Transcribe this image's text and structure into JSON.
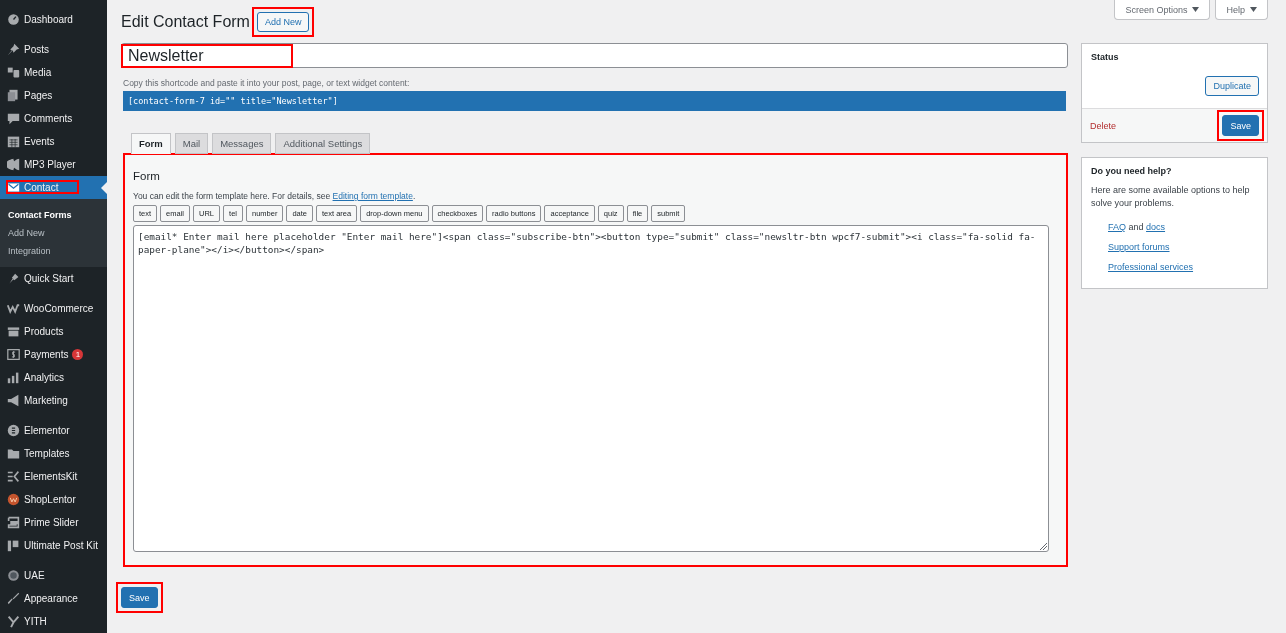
{
  "screen_meta": [
    {
      "label": "Screen Options"
    },
    {
      "label": "Help"
    }
  ],
  "admin_menu": {
    "groups": [
      [
        {
          "label": "Dashboard",
          "selected": false,
          "annotated": false
        }
      ],
      [
        {
          "label": "Posts",
          "selected": false,
          "annotated": false
        },
        {
          "label": "Media",
          "selected": false,
          "annotated": false
        },
        {
          "label": "Pages",
          "selected": false,
          "annotated": false
        },
        {
          "label": "Comments",
          "selected": false,
          "annotated": false
        },
        {
          "label": "Events",
          "selected": false,
          "annotated": false
        },
        {
          "label": "MP3 Player",
          "selected": false,
          "annotated": false
        },
        {
          "label": "Contact",
          "selected": true,
          "annotated": true,
          "submenu": [
            {
              "label": "Contact Forms",
              "selected": true
            },
            {
              "label": "Add New",
              "selected": false
            },
            {
              "label": "Integration",
              "selected": false
            }
          ]
        }
      ],
      [
        {
          "label": "Quick Start",
          "selected": false,
          "annotated": false
        }
      ],
      [
        {
          "label": "WooCommerce",
          "selected": false,
          "annotated": false
        },
        {
          "label": "Products",
          "selected": false,
          "annotated": false
        },
        {
          "label": "Payments",
          "selected": false,
          "annotated": false,
          "badge": "1"
        },
        {
          "label": "Analytics",
          "selected": false,
          "annotated": false
        },
        {
          "label": "Marketing",
          "selected": false,
          "annotated": false
        }
      ],
      [
        {
          "label": "Elementor",
          "selected": false,
          "annotated": false
        },
        {
          "label": "Templates",
          "selected": false,
          "annotated": false
        },
        {
          "label": "ElementsKit",
          "selected": false,
          "annotated": false
        },
        {
          "label": "ShopLentor",
          "selected": false,
          "annotated": false
        },
        {
          "label": "Prime Slider",
          "selected": false,
          "annotated": false
        },
        {
          "label": "Ultimate Post Kit",
          "selected": false,
          "annotated": false
        }
      ],
      [
        {
          "label": "UAE",
          "selected": false,
          "annotated": false
        },
        {
          "label": "Appearance",
          "selected": false,
          "annotated": false
        },
        {
          "label": "YITH",
          "selected": false,
          "annotated": false
        }
      ]
    ]
  },
  "editor": {
    "title": "Edit Contact Form",
    "add_new": {
      "label": "Add New",
      "annotated": true
    },
    "title_field": {
      "value": "Newsletter",
      "annotated": true
    },
    "shortcode_hint": "Copy this shortcode and paste it into your post, page, or text widget content:",
    "shortcode": "[contact-form-7 id=\"\" title=\"Newsletter\"]",
    "tabs": [
      {
        "label": "Form",
        "selected": true
      },
      {
        "label": "Mail",
        "selected": false
      },
      {
        "label": "Messages",
        "selected": false
      },
      {
        "label": "Additional Settings",
        "selected": false
      }
    ],
    "panel": {
      "annotated": true,
      "heading": "Form",
      "description": "You can edit the form template here. For details, see ",
      "description_link": "Editing form template",
      "description_end": ".",
      "tag_buttons": [
        "text",
        "email",
        "URL",
        "tel",
        "number",
        "date",
        "text area",
        "drop-down menu",
        "checkboxes",
        "radio buttons",
        "acceptance",
        "quiz",
        "file",
        "submit"
      ],
      "template": "[email* Enter mail here placeholder \"Enter mail here\"]<span class=\"subscribe-btn\"><button type=\"submit\" class=\"newsltr-btn wpcf7-submit\"><i class=\"fa-solid fa-paper-plane\"></i></button></span>"
    },
    "save_button": {
      "label": "Save",
      "annotated": true
    }
  },
  "status_box": {
    "title": "Status",
    "duplicate": "Duplicate",
    "delete": "Delete",
    "save": {
      "label": "Save",
      "annotated": true
    }
  },
  "help_box": {
    "title": "Do you need help?",
    "text": "Here are some available options to help solve your problems.",
    "links": [
      {
        "parts": [
          {
            "text": "FAQ",
            "link": true
          },
          {
            "text": " and ",
            "link": false
          },
          {
            "text": "docs",
            "link": true
          }
        ]
      },
      {
        "parts": [
          {
            "text": "Support forums",
            "link": true
          }
        ]
      },
      {
        "parts": [
          {
            "text": "Professional services",
            "link": true
          }
        ]
      }
    ]
  }
}
